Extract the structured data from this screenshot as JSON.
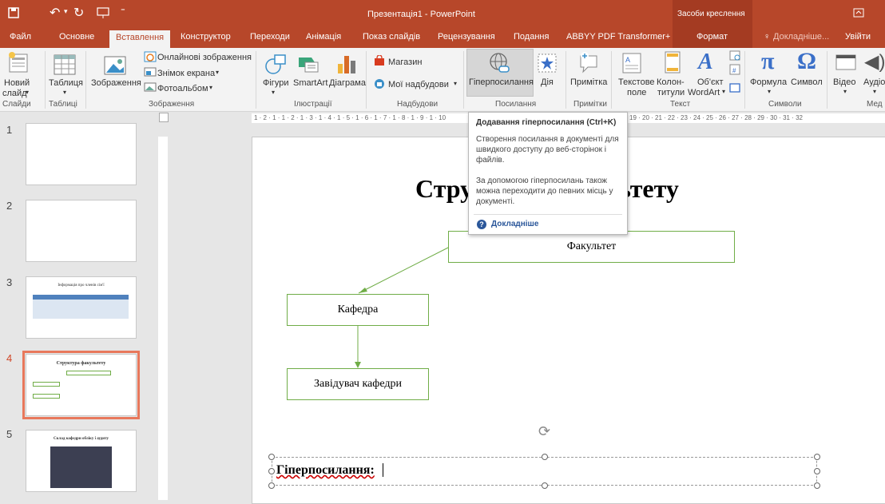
{
  "titlebar": {
    "title": "Презентація1 - PowerPoint",
    "context_tab_group": "Засоби креслення"
  },
  "tabs": {
    "file": "Файл",
    "home": "Основне",
    "insert": "Вставлення",
    "design": "Конструктор",
    "transitions": "Переходи",
    "animations": "Анімація",
    "slideshow": "Показ слайдів",
    "review": "Рецензування",
    "view": "Подання",
    "abbyy": "ABBYY PDF Transformer+",
    "format": "Формат",
    "tellme": "Докладніше...",
    "signin": "Увійти"
  },
  "ribbon": {
    "new_slide": "Новий",
    "new_slide2": "слайд",
    "table": "Таблиця",
    "images": "Зображення",
    "online_images": "Онлайнові зображення",
    "screenshot": "Знімок екрана",
    "photo_album": "Фотоальбом",
    "shapes": "Фігури",
    "smartart": "SmartArt",
    "chart": "Діаграма",
    "store": "Магазин",
    "my_addins": "Мої надбудови",
    "hyperlink": "Гіперпосилання",
    "action": "Дія",
    "comment": "Примітка",
    "textbox": "Текстове",
    "textbox2": "поле",
    "header_footer": "Колон-",
    "header_footer2": "титули",
    "object": "Об'єкт",
    "wordart": "WordArt",
    "equation": "Формула",
    "symbol": "Символ",
    "video": "Відео",
    "audio": "Аудіо",
    "groups": {
      "slides": "Слайди",
      "tables": "Таблиці",
      "images": "Зображення",
      "illustrations": "Ілюстрації",
      "addins": "Надбудови",
      "links": "Посилання",
      "comments": "Примітки",
      "text": "Текст",
      "symbols": "Символи",
      "media": "Мед"
    }
  },
  "ruler": {
    "horizontal": "1 · 2 · 1 · 1 · 2 · 1 · 3 · 1 · 4 · 1 · 5 · 1 · 6 · 1 · 7 · 1 · 8 · 1 · 9 · 1 · 10",
    "horizontal_right": "19 · 20 · 21 · 22 · 23 · 24 · 25 · 26 · 27 · 28 · 29 · 30 · 31 · 32"
  },
  "thumbnails": {
    "n1": "1",
    "n2": "2",
    "n3": "3",
    "n4": "4",
    "n5": "5",
    "t3": "Інформація про членів сім'ї",
    "t4": "Структура факультету",
    "t5": "Склад кафедри обліку і аудиту"
  },
  "slide": {
    "title": "Структура факультету",
    "box_faculty": "Факультет",
    "box_department": "Кафедра",
    "box_head": "Завідувач кафедри",
    "hyperlinks_label": "Гіперпосилання:"
  },
  "tooltip": {
    "title": "Додавання гіперпосилання (Ctrl+K)",
    "p1": "Створення посилання в документі для швидкого доступу до веб-сторінок і файлів.",
    "p2": "За допомогою гіперпосилань також можна переходити до певних місць у документі.",
    "more": "Докладніше"
  },
  "colors": {
    "accent": "#b7472a",
    "shape_border": "#70ad47"
  }
}
